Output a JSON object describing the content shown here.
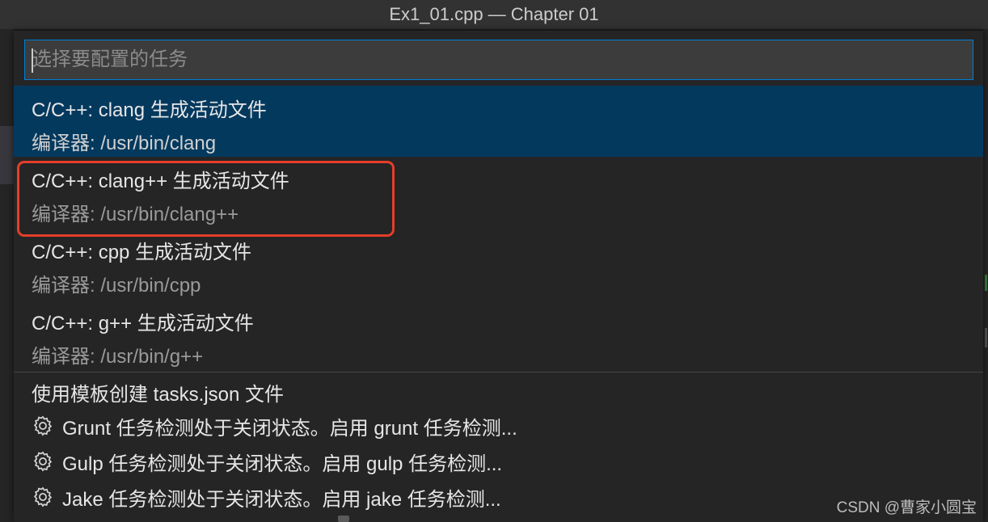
{
  "window": {
    "title": "Ex1_01.cpp — Chapter 01"
  },
  "quick_pick": {
    "placeholder": "选择要配置的任务",
    "value": "",
    "tasks": [
      {
        "label": "C/C++: clang 生成活动文件",
        "detail": "编译器: /usr/bin/clang"
      },
      {
        "label": "C/C++: clang++ 生成活动文件",
        "detail": "编译器: /usr/bin/clang++"
      },
      {
        "label": "C/C++: cpp 生成活动文件",
        "detail": "编译器: /usr/bin/cpp"
      },
      {
        "label": "C/C++: g++ 生成活动文件",
        "detail": "编译器: /usr/bin/g++"
      }
    ],
    "other_items": [
      {
        "label": "使用模板创建 tasks.json 文件",
        "icon": null
      },
      {
        "label": "Grunt 任务检测处于关闭状态。启用 grunt 任务检测...",
        "icon": "gear-icon"
      },
      {
        "label": "Gulp 任务检测处于关闭状态。启用 gulp 任务检测...",
        "icon": "gear-icon"
      },
      {
        "label": "Jake 任务检测处于关闭状态。启用 jake 任务检测...",
        "icon": "gear-icon"
      }
    ]
  },
  "annotation": {
    "color": "#e53e2a"
  },
  "watermark": "CSDN @曹家小圆宝",
  "colors": {
    "selection": "#04395e",
    "focus_border": "#007fd4",
    "panel": "#252526"
  }
}
